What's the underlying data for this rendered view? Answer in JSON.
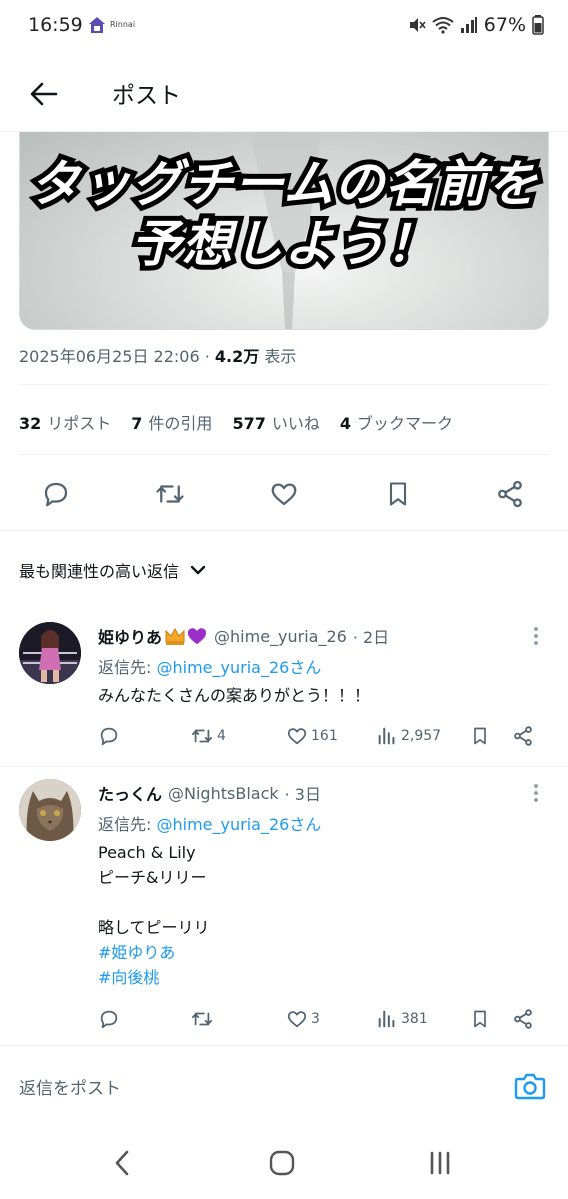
{
  "status_bar": {
    "time": "16:59",
    "app_text": "Rinnai",
    "battery": "67%"
  },
  "header": {
    "title": "ポスト"
  },
  "media": {
    "line1": "タッグチームの名前を",
    "line2": "予想しよう！"
  },
  "meta": {
    "datetime": "2025年06月25日 22:06",
    "separator": "·",
    "views": "4.2万",
    "views_label": "表示"
  },
  "stats": {
    "reposts": "32",
    "reposts_label": "リポスト",
    "quotes": "7",
    "quotes_label": "件の引用",
    "likes": "577",
    "likes_label": "いいね",
    "bookmarks": "4",
    "bookmarks_label": "ブックマーク"
  },
  "sort": {
    "label": "最も関連性の高い返信"
  },
  "replies": [
    {
      "name": "姫ゆりあ",
      "handle": "@hime_yuria_26",
      "time": "· 2日",
      "reply_to_prefix": "返信先: ",
      "reply_to": "@hime_yuria_26さん",
      "lines": [
        "みんなたくさんの案ありがとう！！！"
      ],
      "retweets": "4",
      "likes": "161",
      "views": "2,957"
    },
    {
      "name": "たっくん",
      "handle": "@NightsBlack",
      "time": "· 3日",
      "reply_to_prefix": "返信先: ",
      "reply_to": "@hime_yuria_26さん",
      "lines": [
        "Peach & Lily",
        "ピーチ&リリー",
        "",
        "略してピーリリ"
      ],
      "hashtags": [
        "#姫ゆりあ",
        "#向後桃"
      ],
      "retweets": "",
      "likes": "3",
      "views": "381"
    }
  ],
  "composer": {
    "placeholder": "返信をポスト"
  },
  "colors": {
    "accent": "#1d9bf0",
    "text": "#0f1419",
    "secondary": "#536471",
    "divider": "#eff3f4"
  }
}
